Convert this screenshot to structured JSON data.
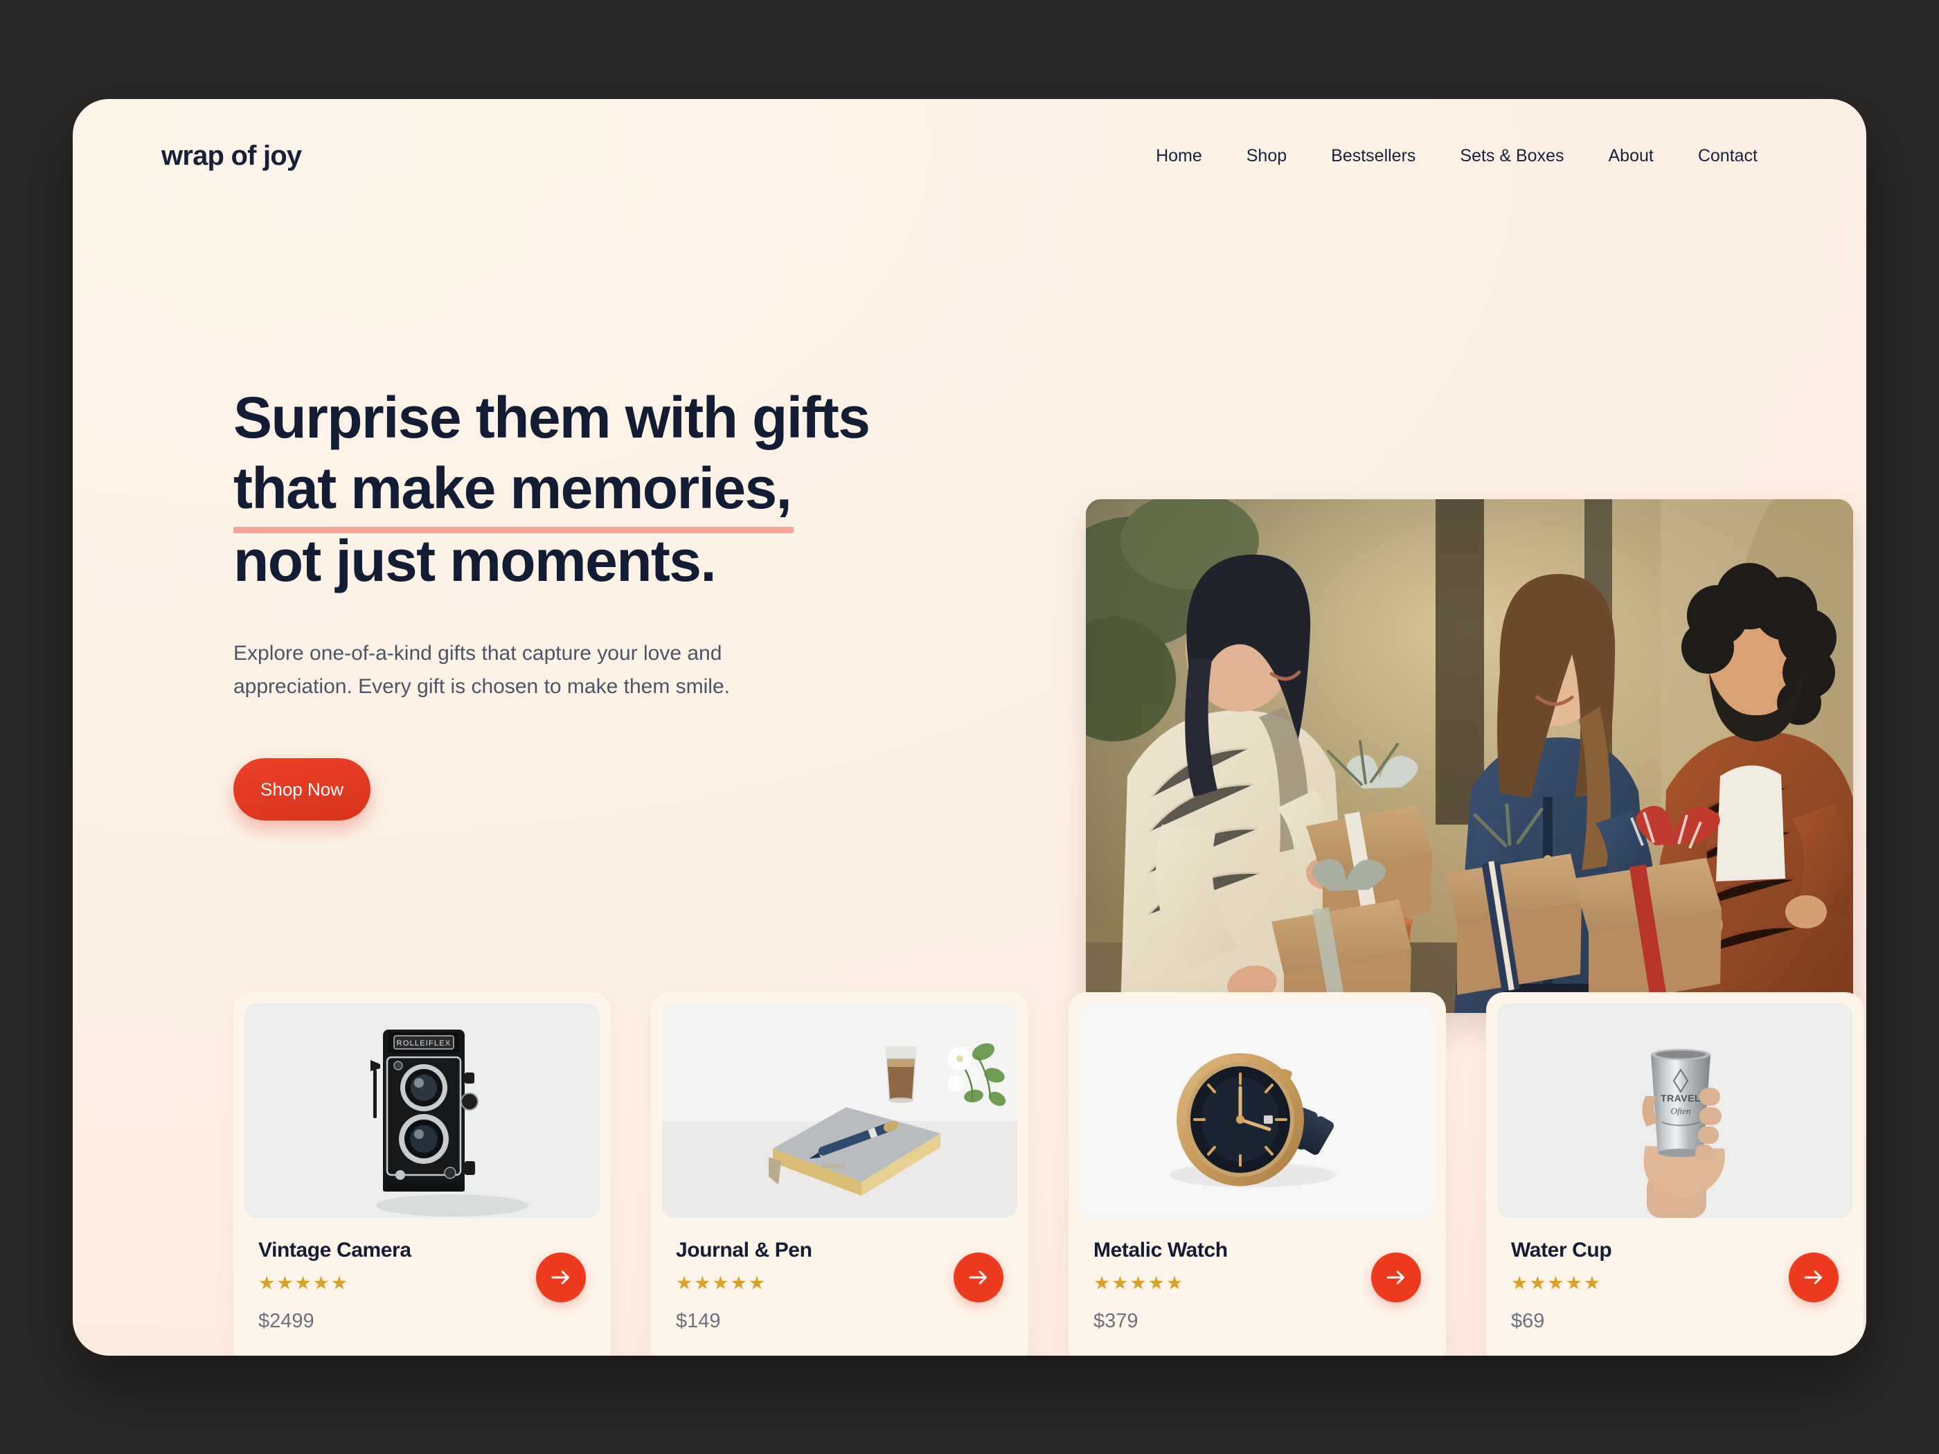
{
  "brand": {
    "name": "wrap of joy"
  },
  "nav": {
    "items": [
      {
        "label": "Home"
      },
      {
        "label": "Shop"
      },
      {
        "label": "Bestsellers"
      },
      {
        "label": "Sets & Boxes"
      },
      {
        "label": "About"
      },
      {
        "label": "Contact"
      }
    ]
  },
  "hero": {
    "headline_line1": "Surprise them with gifts",
    "headline_line2": "that make memories,",
    "headline_line3": "not just moments.",
    "subtext": "Explore one-of-a-kind gifts that capture your love and appreciation. Every gift is chosen to make them smile.",
    "cta_label": "Shop Now",
    "image_alt": "Three friends exchanging wrapped gift boxes outdoors"
  },
  "products": [
    {
      "name": "Vintage Camera",
      "stars": "★★★★★",
      "rating": 5,
      "price": "$2499",
      "image_alt": "Rolleiflex twin-lens vintage camera on light gray background"
    },
    {
      "name": "Journal & Pen",
      "stars": "★★★★★",
      "rating": 5,
      "price": "$149",
      "image_alt": "Gray gold-edged journal with navy pen, coffee glass and white flowers"
    },
    {
      "name": "Metalic Watch",
      "stars": "★★★★★",
      "rating": 5,
      "price": "$379",
      "image_alt": "Gold-rimmed watch with dark navy dial and metal bracelet"
    },
    {
      "name": "Water Cup",
      "stars": "★★★★★",
      "rating": 5,
      "price": "$69",
      "image_alt": "Hand holding a stainless steel travel cup against white wall"
    }
  ],
  "colors": {
    "accent_red": "#EE3B20",
    "underline_coral": "#F9A294",
    "ink_navy": "#131C35",
    "body_gray": "#4D5467",
    "star_gold": "#D9A227",
    "page_cream": "#FDF4E9",
    "card_cream": "#FDF4EA",
    "backdrop": "#2b2927"
  },
  "icons": {
    "arrow_right": "arrow-right-icon"
  }
}
